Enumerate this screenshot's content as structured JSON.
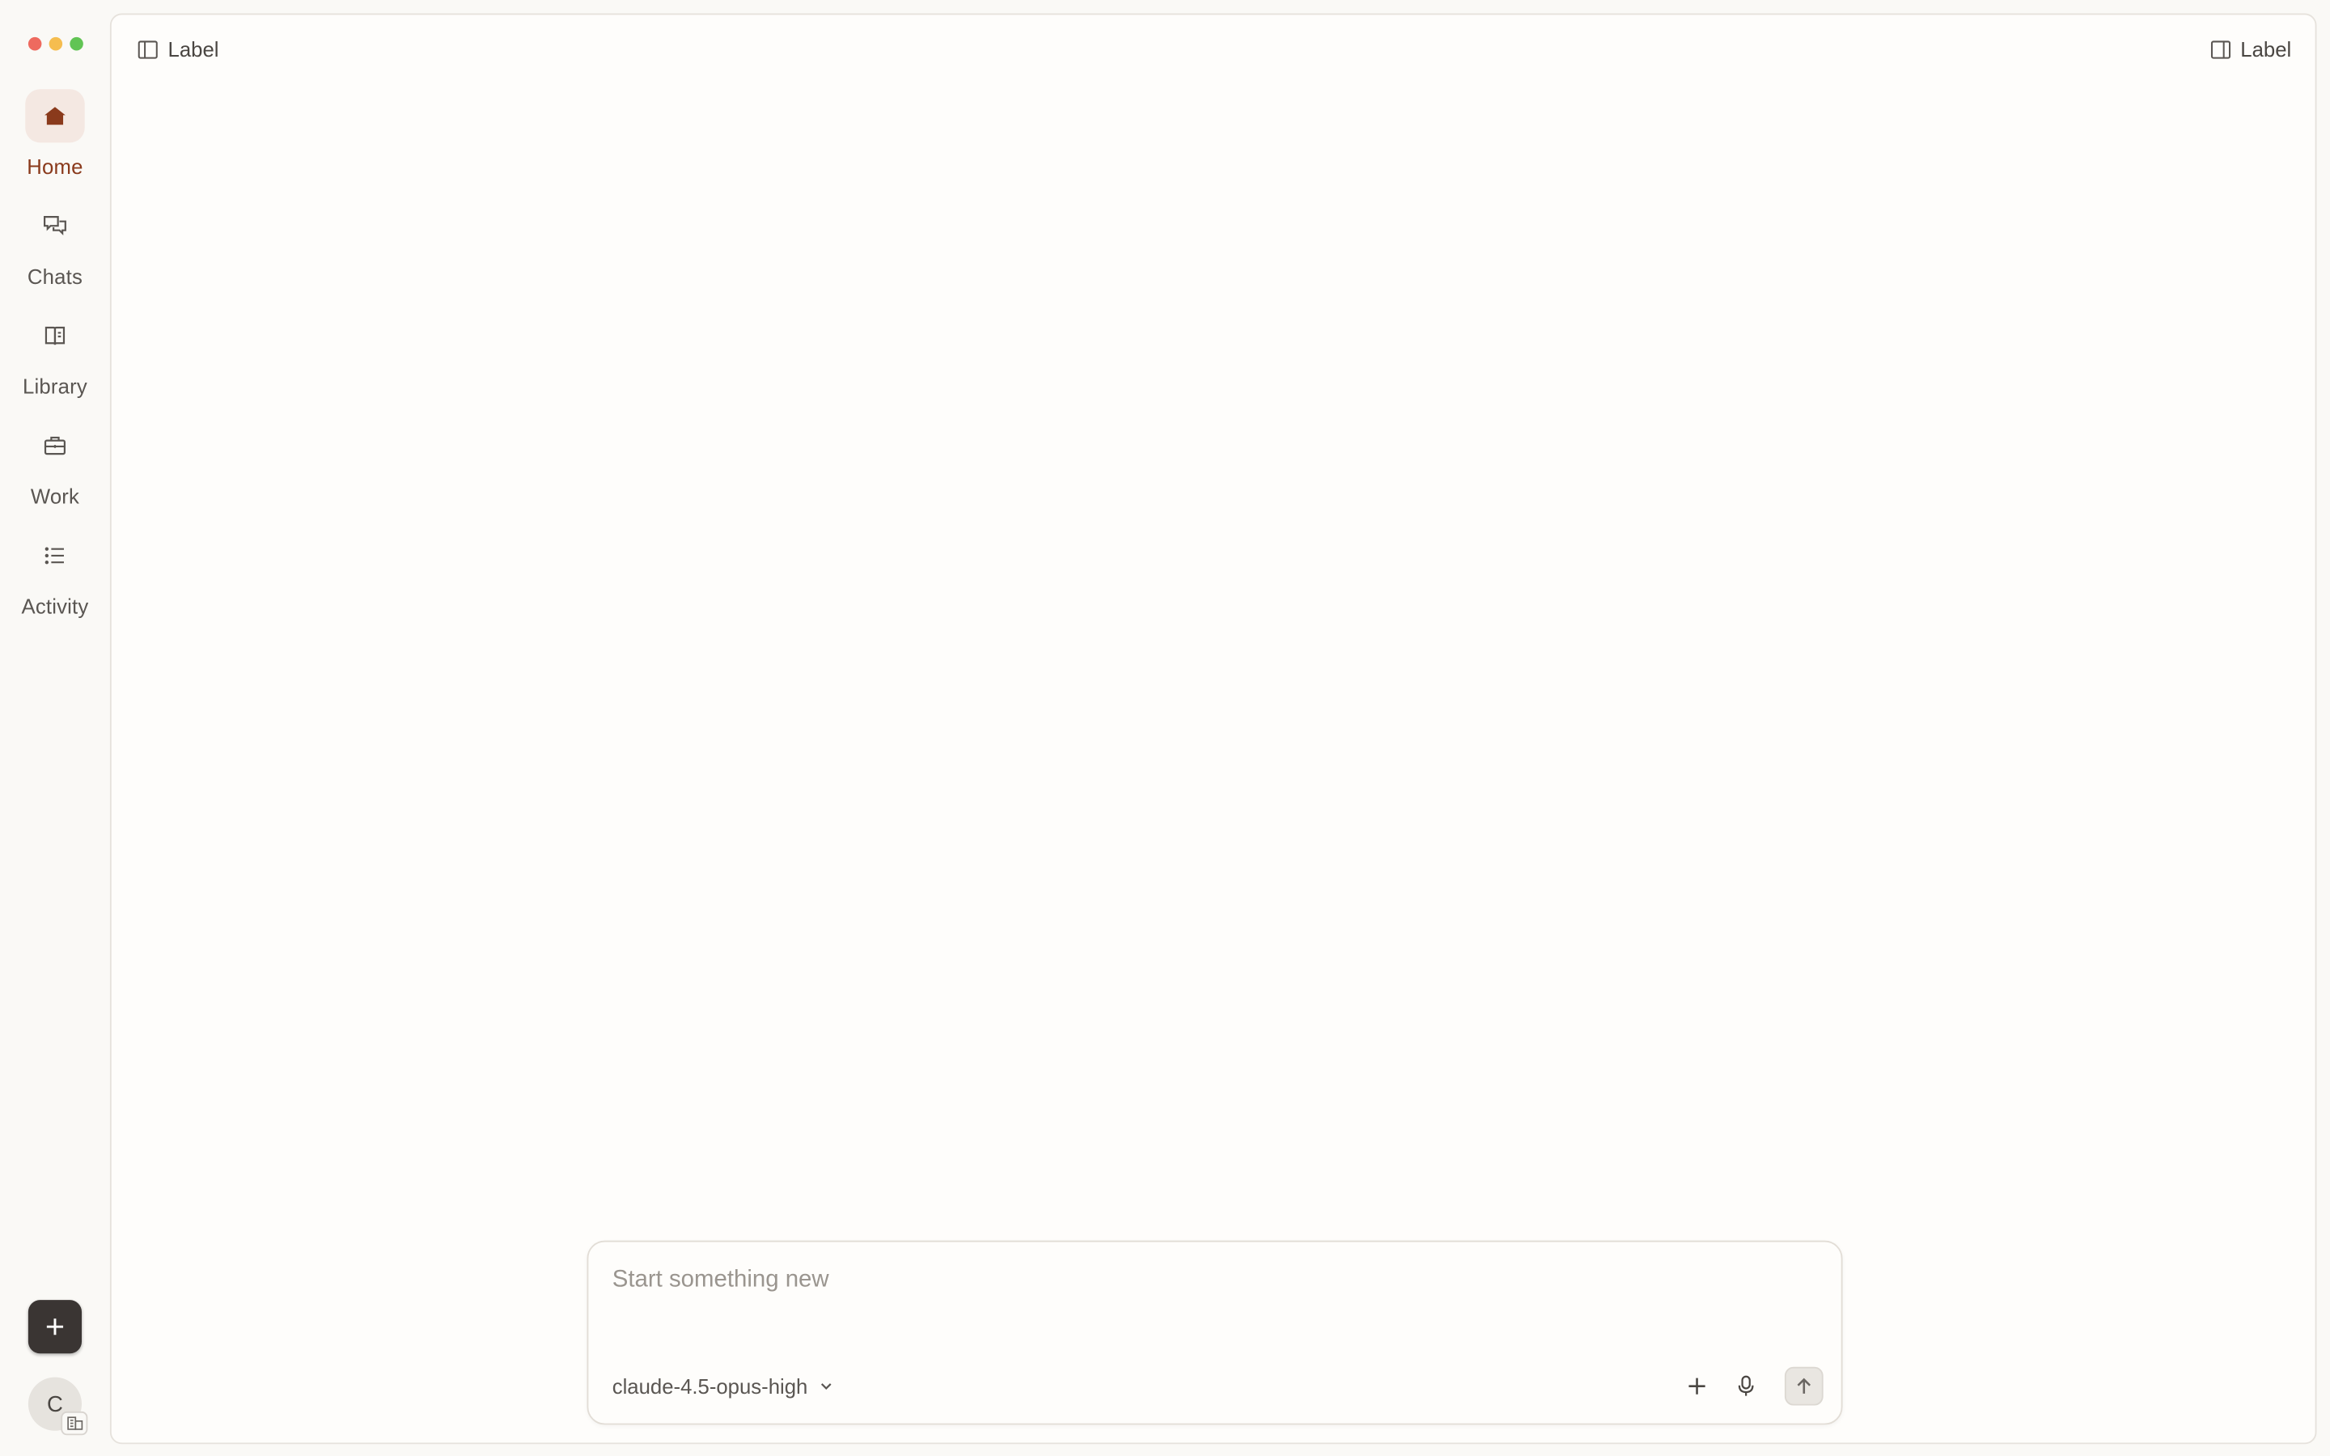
{
  "window": {
    "controls": [
      "close",
      "minimize",
      "zoom"
    ]
  },
  "sidebar": {
    "items": [
      {
        "label": "Home",
        "icon": "home-icon",
        "active": true
      },
      {
        "label": "Chats",
        "icon": "chats-icon",
        "active": false
      },
      {
        "label": "Library",
        "icon": "library-icon",
        "active": false
      },
      {
        "label": "Work",
        "icon": "work-icon",
        "active": false
      },
      {
        "label": "Activity",
        "icon": "activity-icon",
        "active": false
      }
    ],
    "new_button_icon": "plus-icon",
    "avatar_initial": "C"
  },
  "header": {
    "left_toggle_label": "Label",
    "right_toggle_label": "Label"
  },
  "composer": {
    "placeholder": "Start something new",
    "value": "",
    "model": "claude-4.5-opus-high"
  },
  "colors": {
    "accent": "#8a3a1c",
    "accent_bg": "#f4e8e2",
    "background": "#faf9f6",
    "panel": "#fefdfb",
    "dark_button": "#3a3533"
  }
}
